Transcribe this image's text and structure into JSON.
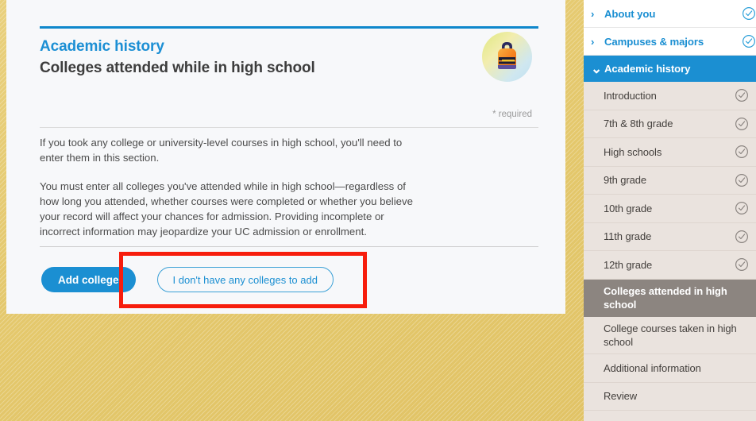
{
  "card": {
    "eyebrow": "Academic history",
    "title": "Colleges attended while in high school",
    "required_note": "* required",
    "badge_icon": "backpack-icon",
    "paragraphs": [
      "If you took any college or university-level courses in high school, you'll need to enter them in this section.",
      "You must enter all colleges you've attended while in high school—regardless of how long you attended, whether courses were completed or whether you believe your record will affect your chances for admission. Providing incomplete or incorrect information may jeopardize your UC admission or enrollment."
    ],
    "buttons": {
      "primary_label": "Add college",
      "secondary_label": "I don't have any colleges to add"
    }
  },
  "annotation": {
    "color": "#f71d0c"
  },
  "sidebar": {
    "sections": [
      {
        "label": "About you",
        "state": "collapsed",
        "chevron": "chevron-right-icon",
        "checked": true
      },
      {
        "label": "Campuses & majors",
        "state": "collapsed",
        "chevron": "chevron-right-icon",
        "checked": true
      },
      {
        "label": "Academic history",
        "state": "expanded",
        "chevron": "chevron-down-icon",
        "checked": false
      }
    ],
    "items": [
      {
        "label": "Introduction",
        "checked": true,
        "selected": false
      },
      {
        "label": "7th & 8th grade",
        "checked": true,
        "selected": false
      },
      {
        "label": "High schools",
        "checked": true,
        "selected": false
      },
      {
        "label": "9th grade",
        "checked": true,
        "selected": false
      },
      {
        "label": "10th grade",
        "checked": true,
        "selected": false
      },
      {
        "label": "11th grade",
        "checked": true,
        "selected": false
      },
      {
        "label": "12th grade",
        "checked": true,
        "selected": false
      },
      {
        "label": "Colleges attended in high school",
        "checked": false,
        "selected": true
      },
      {
        "label": "College courses taken in high school",
        "checked": false,
        "selected": false
      },
      {
        "label": "Additional information",
        "checked": false,
        "selected": false
      },
      {
        "label": "Review",
        "checked": false,
        "selected": false
      }
    ]
  },
  "colors": {
    "accent_blue": "#1b8fd2",
    "selected_gray": "#8c8580",
    "sidebar_beige": "#eae3de",
    "page_gold": "#e3c766"
  }
}
